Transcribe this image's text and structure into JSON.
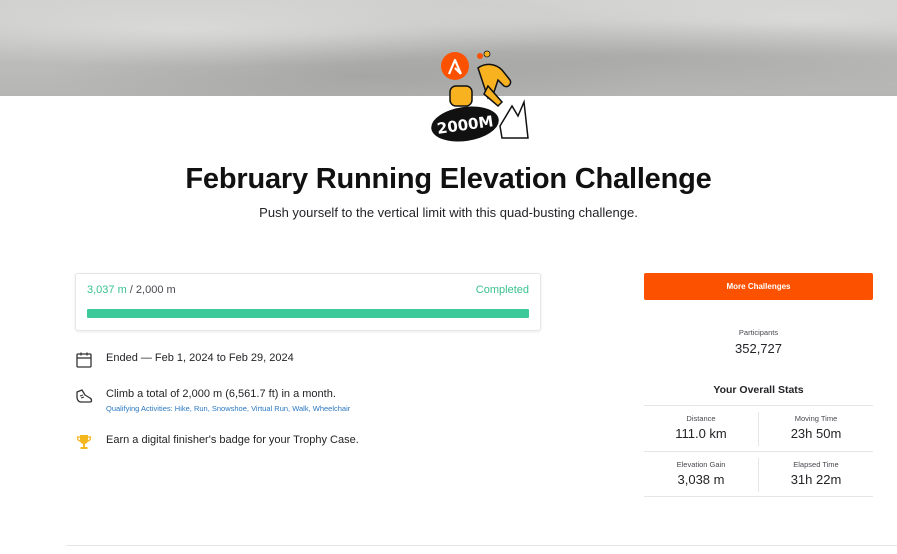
{
  "badge": {
    "label": "2000M"
  },
  "challenge": {
    "title": "February Running Elevation Challenge",
    "subtitle": "Push yourself to the vertical limit with this quad-busting challenge."
  },
  "progress": {
    "current": "3,037 m",
    "separator": " / ",
    "goal": "2,000 m",
    "status": "Completed",
    "fraction": 1.0
  },
  "details": [
    {
      "icon": "calendar-icon",
      "text": "Ended — Feb 1, 2024 to Feb 29, 2024"
    },
    {
      "icon": "shoe-icon",
      "text": "Climb a total of 2,000 m (6,561.7 ft) in a month.",
      "sub": "Qualifying Activities: Hike, Run, Snowshoe, Virtual Run, Walk, Wheelchair"
    },
    {
      "icon": "trophy-icon",
      "text": "Earn a digital finisher's badge for your Trophy Case."
    }
  ],
  "sidebar": {
    "more_button": "More Challenges",
    "participants_label": "Participants",
    "participants_value": "352,727",
    "stats_title": "Your Overall Stats",
    "stats": [
      {
        "label": "Distance",
        "value": "111.0 km"
      },
      {
        "label": "Moving Time",
        "value": "23h 50m"
      },
      {
        "label": "Elevation Gain",
        "value": "3,038 m"
      },
      {
        "label": "Elapsed Time",
        "value": "31h 22m"
      }
    ]
  },
  "colors": {
    "brand": "#fc5200",
    "progress": "#3ec99a",
    "link": "#2a78c2"
  }
}
